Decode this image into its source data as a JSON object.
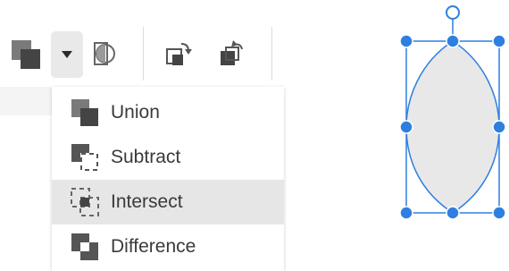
{
  "toolbar": {
    "buttons": [
      {
        "name": "boolean-operations",
        "icon": "union-squares-icon"
      },
      {
        "name": "boolean-dropdown",
        "icon": "caret-down-icon"
      },
      {
        "name": "mask",
        "icon": "mask-icon"
      },
      {
        "name": "bring-forward",
        "icon": "bring-forward-icon"
      },
      {
        "name": "send-backward",
        "icon": "send-backward-icon"
      }
    ]
  },
  "menu": {
    "items": [
      {
        "label": "Union",
        "icon": "union-icon",
        "selected": false
      },
      {
        "label": "Subtract",
        "icon": "subtract-icon",
        "selected": false
      },
      {
        "label": "Intersect",
        "icon": "intersect-icon",
        "selected": true
      },
      {
        "label": "Difference",
        "icon": "difference-icon",
        "selected": false
      }
    ]
  },
  "colors": {
    "icon_dark": "#444444",
    "icon_mid": "#7a7a7a",
    "selection_blue": "#2f7fe0",
    "shape_fill": "#e8e8e8",
    "menu_selected_bg": "#e6e6e6",
    "dropdown_bg": "#e9e9e9"
  }
}
